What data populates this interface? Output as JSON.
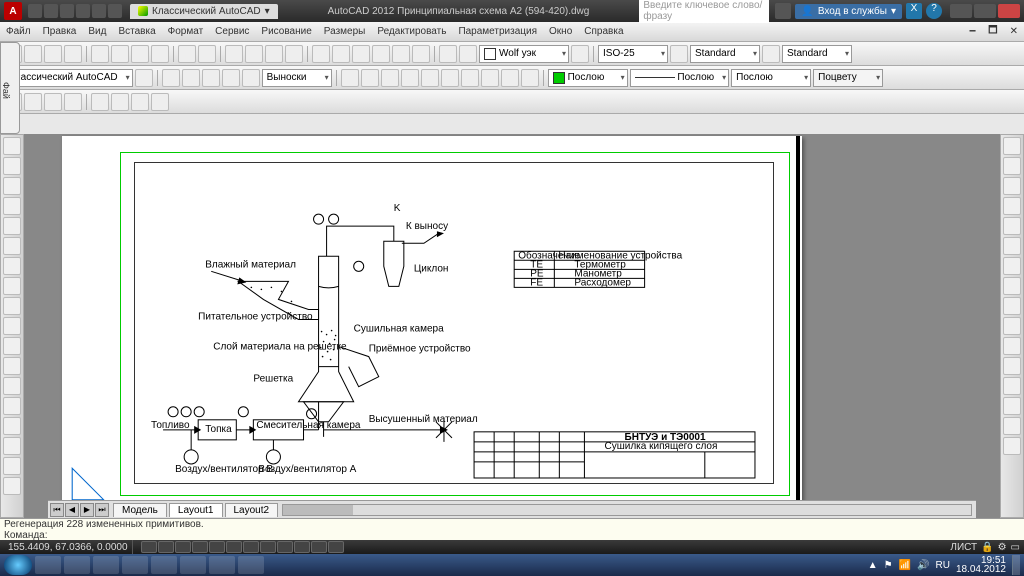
{
  "titlebar": {
    "logo": "A",
    "doc_tab": "Классический AutoCAD",
    "app_title": "AutoCAD 2012   Принципиальная схема A2 (594-420).dwg",
    "search_placeholder": "Введите ключевое слово/фразу",
    "login": "Вход в службы"
  },
  "menu": [
    "Файл",
    "Правка",
    "Вид",
    "Вставка",
    "Формат",
    "Сервис",
    "Рисование",
    "Размеры",
    "Редактировать",
    "Параметризация",
    "Окно",
    "Справка"
  ],
  "tb1": {
    "workspace": "Классический AutoCAD",
    "callouts": "Выноски"
  },
  "tb2": {
    "layer_color": "Wolf уэк",
    "dim_style": "ISO-25",
    "text_style1": "Standard",
    "text_style2": "Standard"
  },
  "tb3": {
    "bylayer1": "Послою",
    "bylayer2": "Послою",
    "bylayer3": "Послою",
    "bycolor": "Поцвету"
  },
  "drawing": {
    "labels": {
      "k_vynosu": "К выносу",
      "ciklon": "Циклон",
      "vlazhny": "Влажный материал",
      "pitatel": "Питательное устройство",
      "sloy": "Слой материала на решетке",
      "reshetka": "Решетка",
      "sushilnaya": "Сушильная камера",
      "priemnoe": "Приёмное устройство",
      "vysushenny": "Высушенный материал",
      "toplivo": "Топливо",
      "topka": "Топка",
      "smesitel": "Смесительная камера",
      "vozduh1": "Воздух/вентилятор В",
      "vozduh2": "Воздух/вентилятор А",
      "legend_head1": "Обозначение",
      "legend_head2": "Наименование устройства",
      "legend_r1": "Термометр",
      "legend_r2": "Манометр",
      "legend_r3": "Расходомер",
      "legend_c1": "TE",
      "legend_c2": "PE",
      "legend_c3": "FE",
      "stamp_title": "БНТУЭ и ТЭ0001",
      "stamp_sub": "Сушилка кипящего слоя"
    }
  },
  "layout_tabs": [
    "Модель",
    "Layout1",
    "Layout2"
  ],
  "cmd": {
    "line1": "Регенерация 228 измененных примитивов.",
    "line2": "Команда:"
  },
  "status": {
    "coords": "155.4409, 67.0366, 0.0000",
    "model": "ЛИСТ"
  },
  "tray": {
    "lang": "RU",
    "time": "19:51",
    "date": "18.04.2012"
  },
  "fai": "Фай"
}
